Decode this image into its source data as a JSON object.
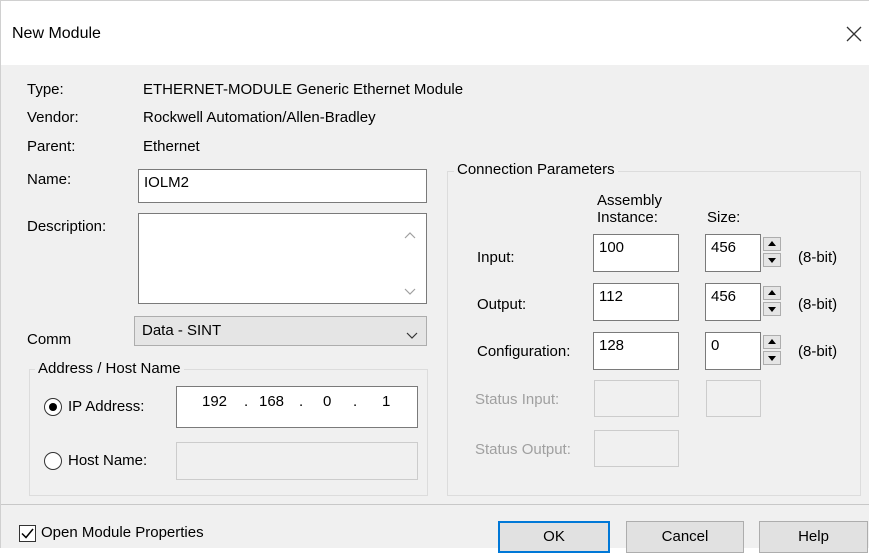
{
  "window": {
    "title": "New Module",
    "close_icon": "close-icon"
  },
  "info": {
    "type_label": "Type:",
    "type_value": "ETHERNET-MODULE Generic Ethernet Module",
    "vendor_label": "Vendor:",
    "vendor_value": "Rockwell Automation/Allen-Bradley",
    "parent_label": "Parent:",
    "parent_value": "Ethernet",
    "name_label": "Name:",
    "name_value": "IOLM2",
    "description_label": "Description:",
    "description_value": "",
    "comm_label": "Comm",
    "comm_value": "Data - SINT"
  },
  "address": {
    "group_title": "Address / Host Name",
    "ip_label": "IP Address:",
    "ip_octets": [
      "192",
      "168",
      "0",
      "1"
    ],
    "host_label": "Host Name:",
    "host_value": "",
    "selected": "ip"
  },
  "connection": {
    "group_title": "Connection Parameters",
    "assembly_header": "Assembly",
    "instance_header": "Instance:",
    "size_header": "Size:",
    "rows": [
      {
        "label": "Input:",
        "instance": "100",
        "size": "456",
        "unit": "(8-bit)"
      },
      {
        "label": "Output:",
        "instance": "112",
        "size": "456",
        "unit": "(8-bit)"
      },
      {
        "label": "Configuration:",
        "instance": "128",
        "size": "0",
        "unit": "(8-bit)"
      }
    ],
    "status_input_label": "Status Input:",
    "status_output_label": "Status Output:"
  },
  "footer": {
    "open_props_label": "Open Module Properties",
    "open_props_checked": true,
    "ok_label": "OK",
    "cancel_label": "Cancel",
    "help_label": "Help"
  },
  "colors": {
    "accent": "#0078d7",
    "background": "#f0f0f0"
  }
}
